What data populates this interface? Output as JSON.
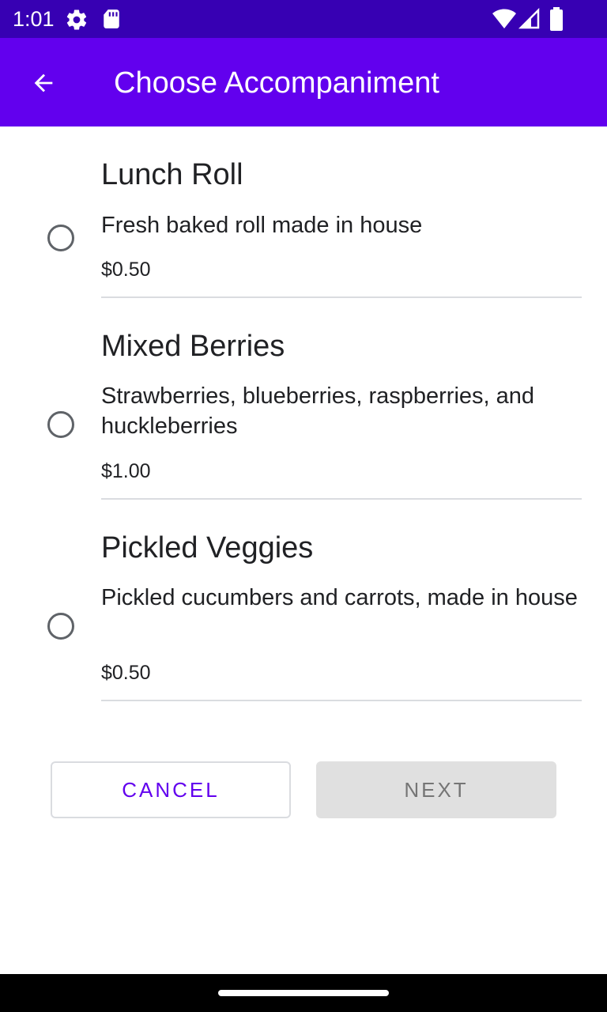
{
  "status_bar": {
    "time": "1:01",
    "icons": [
      "gear-icon",
      "sd-card-icon",
      "wifi-icon",
      "signal-icon",
      "battery-icon"
    ]
  },
  "app_bar": {
    "title": "Choose Accompaniment",
    "back_icon": "arrow-back-icon",
    "background_color": "#6200ee"
  },
  "options": [
    {
      "title": "Lunch Roll",
      "description": "Fresh baked roll made in house",
      "price": "$0.50",
      "selected": false
    },
    {
      "title": "Mixed Berries",
      "description": "Strawberries, blueberries, raspberries, and huckleberries",
      "price": "$1.00",
      "selected": false
    },
    {
      "title": "Pickled Veggies",
      "description": "Pickled cucumbers and carrots, made in house",
      "price": "$0.50",
      "selected": false
    }
  ],
  "buttons": {
    "cancel_label": "CANCEL",
    "next_label": "NEXT",
    "next_enabled": false
  },
  "colors": {
    "status_bar": "#3700b3",
    "accent": "#6200ee",
    "disabled_button": "#e0e0e0"
  }
}
